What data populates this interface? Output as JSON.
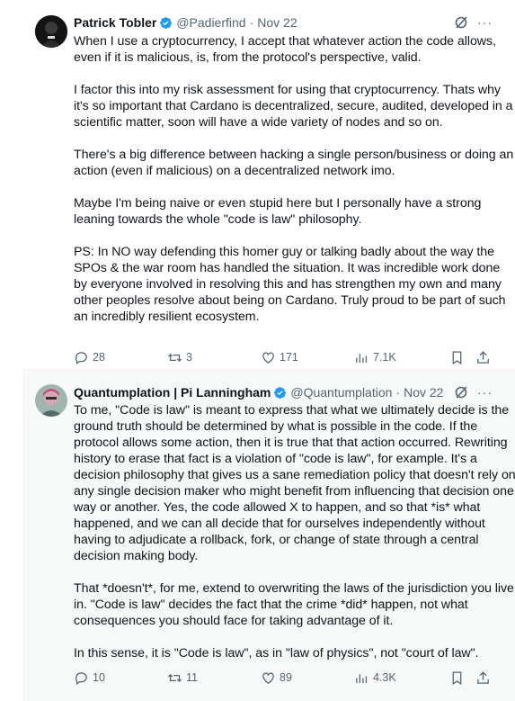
{
  "tweets": [
    {
      "name": "Patrick Tobler",
      "handle": "@Padierfind",
      "separator": "·",
      "date": "Nov 22",
      "more": "···",
      "text": "When I use a cryptocurrency, I accept that whatever action the code allows, even if it is malicious, is, from the protocol's perspective, valid.\n\nI factor this into my risk assessment for using that cryptocurrency. Thats why it's so important that Cardano is decentralized, secure, audited, developed in a scientific matter, soon will have a wide variety of nodes and so on.\n\nThere's a big difference between hacking a single person/business or doing an action (even if malicious) on a decentralized network imo.\n\nMaybe I'm being naive or even stupid here but I personally have a strong leaning towards the whole \"code is law\" philosophy.\n\nPS: In NO way defending this homer guy or talking badly about the way the SPOs & the war room has handled the situation. It was incredible work done by everyone involved in resolving this and has strengthen my own and many other peoples resolve about being on Cardano. Truly proud to be part of such an incredibly resilient ecosystem.",
      "replies": "28",
      "retweets": "3",
      "likes": "171",
      "views": "7.1K"
    },
    {
      "name": "Quantumplation | Pi Lanningham",
      "handle": "@Quantumplation",
      "separator": "·",
      "date": "Nov 22",
      "more": "···",
      "text": "To me, \"Code is law\" is meant to express that what we ultimately decide is the ground truth should be determined by what is possible in the code. If the protocol allows some action, then it is true that that action occurred. Rewriting history to erase that fact is a violation of \"code is law\", for example. It's a decision philosophy that gives us a sane remediation policy that doesn't rely on any single decision maker who might benefit from influencing that decision one way or another. Yes, the code allowed X to happen, and so that *is* what happened, and we can all decide that for ourselves independently without having to adjudicate a rollback, fork, or change of state through a central decision making body.\n\nThat *doesn't*, for me, extend to overwriting the laws of the jurisdiction you live in. \"Code is law\" decides the fact that the crime *did* happen, not what consequences you should face for taking advantage of it.\n\nIn this sense, it is \"Code is law\", as in \"law of physics\", not \"court of law\".",
      "replies": "10",
      "retweets": "11",
      "likes": "89",
      "views": "4.3K"
    }
  ],
  "colors": {
    "verified": "#1d9bf0",
    "secondary_text": "#536471",
    "reply_background": "#f7f9f9"
  },
  "icons": [
    "verified-badge-icon",
    "grok-icon",
    "more-icon",
    "reply-icon",
    "retweet-icon",
    "like-icon",
    "views-icon",
    "bookmark-icon",
    "share-icon"
  ]
}
